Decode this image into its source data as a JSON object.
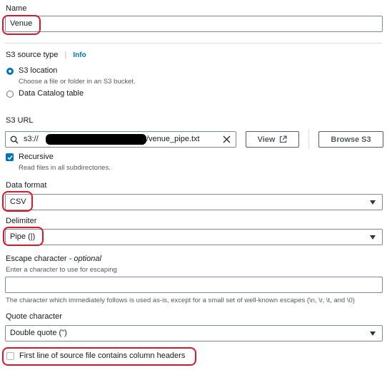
{
  "name": {
    "label": "Name",
    "value": "Venue"
  },
  "s3_source_type": {
    "label": "S3 source type",
    "info_link": "Info",
    "options": [
      {
        "label": "S3 location",
        "description": "Choose a file or folder in an S3 bucket.",
        "selected": true
      },
      {
        "label": "Data Catalog table",
        "selected": false
      }
    ]
  },
  "s3_url": {
    "label": "S3 URL",
    "value_prefix": "s3://",
    "value_suffix": "/venue_pipe.txt",
    "view_button": "View",
    "browse_button": "Browse S3",
    "recursive": {
      "label": "Recursive",
      "description": "Read files in all subdirectories.",
      "checked": true
    }
  },
  "data_format": {
    "label": "Data format",
    "value": "CSV"
  },
  "delimiter": {
    "label": "Delimiter",
    "value": "Pipe (|)"
  },
  "escape_character": {
    "label": "Escape character",
    "optional": "- optional",
    "hint": "Enter a character to use for escaping",
    "value": "",
    "help": "The character which immediately follows is used as-is, except for a small set of well-known escapes (\\n, \\r, \\t, and \\0)"
  },
  "quote_character": {
    "label": "Quote character",
    "value": "Double quote (\")"
  },
  "first_line_header": {
    "label": "First line of source file contains column headers",
    "checked": false
  },
  "colors": {
    "accent": "#0073bb",
    "highlight": "#e0152a",
    "redaction": "#000000"
  }
}
